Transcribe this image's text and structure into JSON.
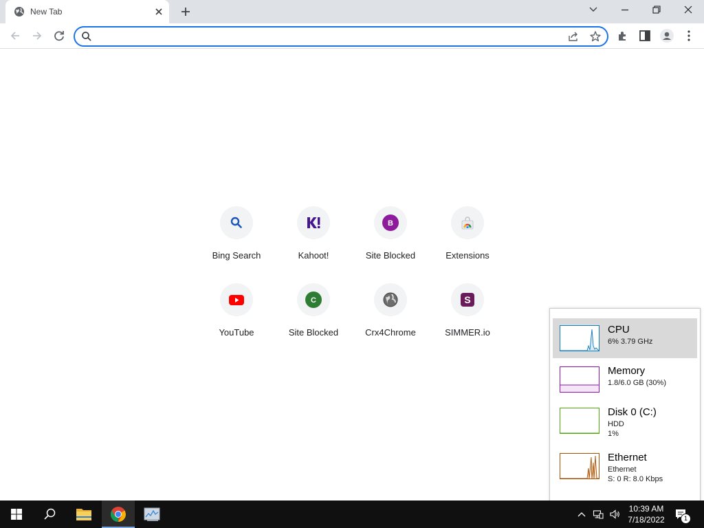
{
  "browser": {
    "tab_title": "New Tab",
    "omnibox_value": "",
    "omnibox_placeholder": ""
  },
  "shortcuts": [
    {
      "label": "Bing Search",
      "icon": "search-icon",
      "color": "#1a56b8"
    },
    {
      "label": "Kahoot!",
      "icon": "kahoot-icon",
      "color": "#46178f"
    },
    {
      "label": "Site Blocked",
      "icon": "letter-b-icon",
      "color": "#8e1b9c",
      "letter": "B"
    },
    {
      "label": "Extensions",
      "icon": "chrome-store-icon",
      "color": "#e8453c"
    },
    {
      "label": "YouTube",
      "icon": "youtube-icon",
      "color": "#ff0000"
    },
    {
      "label": "Site Blocked",
      "icon": "letter-c-icon",
      "color": "#2e7d32",
      "letter": "C"
    },
    {
      "label": "Crx4Chrome",
      "icon": "globe-icon",
      "color": "#555555"
    },
    {
      "label": "SIMMER.io",
      "icon": "simmer-icon",
      "color": "#6a1b5a",
      "letter": "S"
    }
  ],
  "task_manager": {
    "items": [
      {
        "name": "CPU",
        "line1": "6% 3.79 GHz",
        "line2": "",
        "color": "#117dbb",
        "selected": true
      },
      {
        "name": "Memory",
        "line1": "1.8/6.0 GB (30%)",
        "line2": "",
        "color": "#8b12ae",
        "selected": false
      },
      {
        "name": "Disk 0 (C:)",
        "line1": "HDD",
        "line2": "1%",
        "color": "#4da60c",
        "selected": false
      },
      {
        "name": "Ethernet",
        "line1": "Ethernet",
        "line2": "S: 0 R: 8.0 Kbps",
        "color": "#a74f01",
        "selected": false
      }
    ]
  },
  "taskbar": {
    "time": "10:39 AM",
    "date": "7/18/2022",
    "notification_count": "1"
  }
}
